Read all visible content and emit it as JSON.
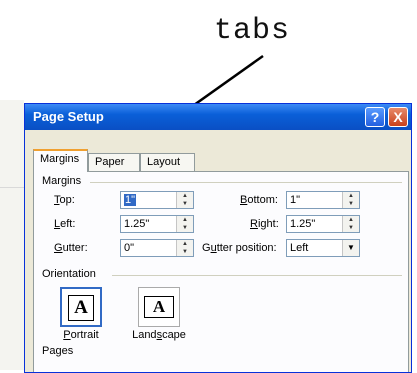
{
  "annotation": {
    "text": "tabs"
  },
  "dialog": {
    "title": "Page Setup",
    "help_label": "?",
    "close_label": "X",
    "tabs": [
      "Margins",
      "Paper",
      "Layout"
    ],
    "active_tab": "Margins",
    "margins": {
      "group_label": "Margins",
      "top_label": "Top:",
      "top_value": "1\"",
      "bottom_label": "Bottom:",
      "bottom_value": "1\"",
      "left_label": "Left:",
      "left_value": "1.25\"",
      "right_label": "Right:",
      "right_value": "1.25\"",
      "gutter_label": "Gutter:",
      "gutter_value": "0\"",
      "gutter_position_label": "Gutter position:",
      "gutter_position_value": "Left"
    },
    "orientation": {
      "group_label": "Orientation",
      "portrait_label": "Portrait",
      "landscape_label": "Landscape",
      "selected": "Portrait",
      "icon_letter": "A"
    },
    "pages": {
      "group_label": "Pages"
    }
  }
}
